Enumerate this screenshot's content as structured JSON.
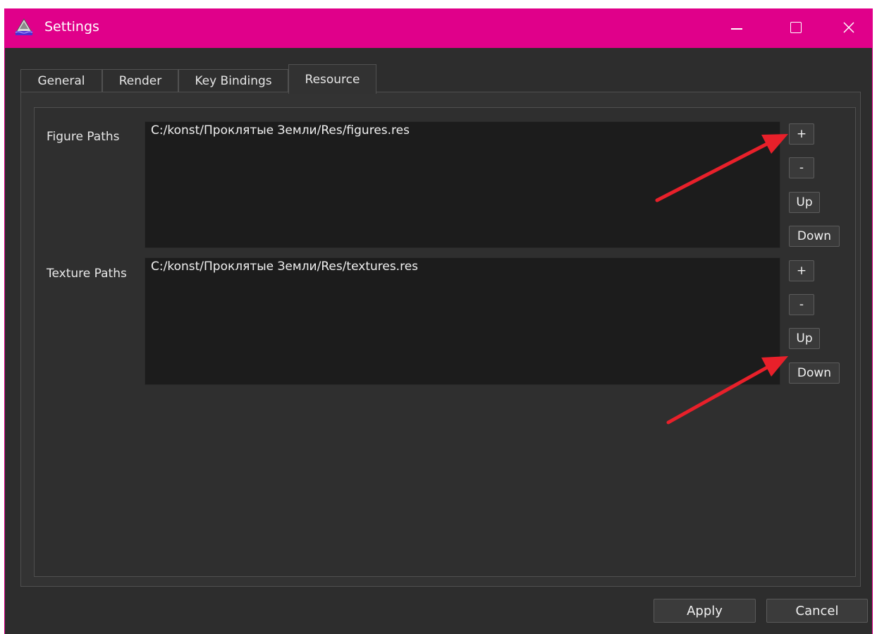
{
  "window": {
    "title": "Settings"
  },
  "tabs": [
    "General",
    "Render",
    "Key Bindings",
    "Resource"
  ],
  "resource": {
    "figure": {
      "label": "Figure Paths",
      "items": [
        "C:/konst/Проклятые Земли/Res/figures.res"
      ]
    },
    "texture": {
      "label": "Texture Paths",
      "items": [
        "C:/konst/Проклятые Земли/Res/textures.res"
      ]
    },
    "buttons": {
      "add": "+",
      "remove": "-",
      "up": "Up",
      "down": "Down"
    }
  },
  "dialog": {
    "apply": "Apply",
    "cancel": "Cancel"
  },
  "colors": {
    "titlebar": "#e0008a",
    "annotation_arrow": "#e8202a",
    "background": "#2d2d2d"
  },
  "icons": {
    "app": "app-icon",
    "minimize": "minimize-icon",
    "maximize": "maximize-icon",
    "close": "close-icon"
  }
}
